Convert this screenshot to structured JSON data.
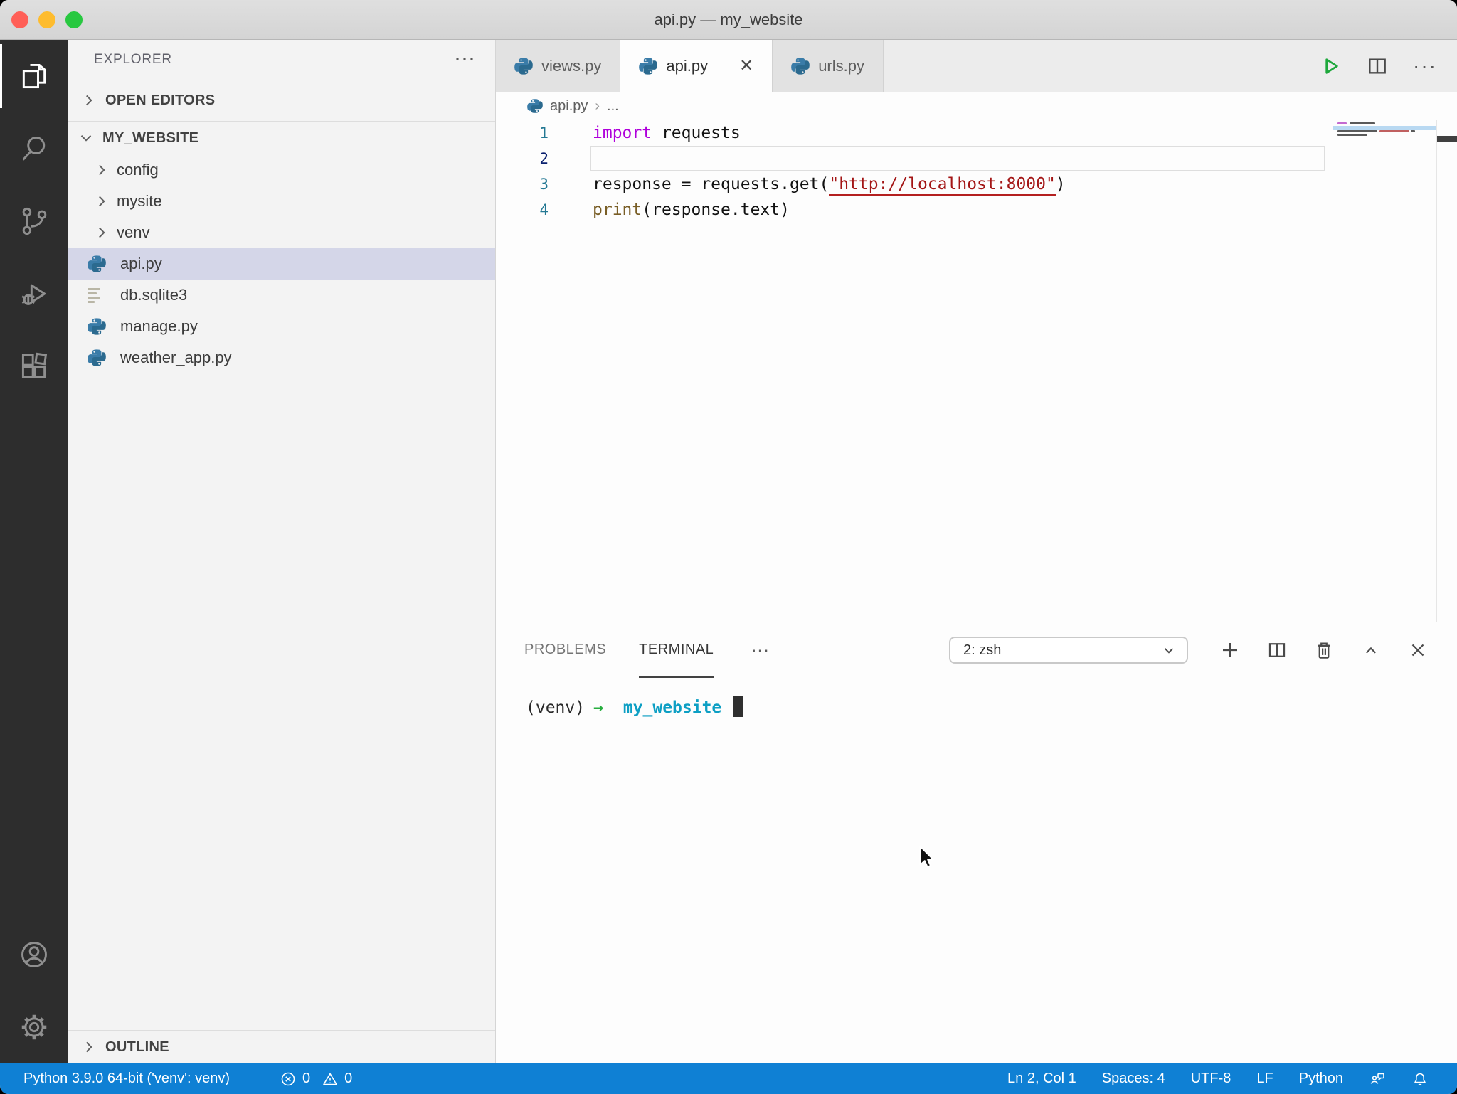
{
  "window": {
    "title": "api.py — my_website"
  },
  "activity_bar": {
    "items": [
      "Explorer",
      "Search",
      "Source Control",
      "Run and Debug",
      "Extensions",
      "Accounts",
      "Settings"
    ]
  },
  "sidebar": {
    "header": "EXPLORER",
    "header_menu": "⋯",
    "open_editors": "OPEN EDITORS",
    "root": "MY_WEBSITE",
    "outline": "OUTLINE",
    "tree": [
      {
        "label": "config"
      },
      {
        "label": "mysite"
      },
      {
        "label": "venv"
      },
      {
        "label": "api.py"
      },
      {
        "label": "db.sqlite3"
      },
      {
        "label": "manage.py"
      },
      {
        "label": "weather_app.py"
      }
    ]
  },
  "editor": {
    "tabs": [
      {
        "label": "views.py"
      },
      {
        "label": "api.py",
        "close": "✕"
      },
      {
        "label": "urls.py"
      }
    ],
    "breadcrumb": {
      "file": "api.py",
      "sep": "›",
      "more": "..."
    },
    "code": {
      "lines": [
        {
          "num": "1",
          "tokens": [
            {
              "t": "import"
            },
            {
              "t": " requests"
            }
          ]
        },
        {
          "num": "2",
          "tokens": []
        },
        {
          "num": "3",
          "tokens": [
            {
              "t": "response = requests.get("
            },
            {
              "t": "\"http://localhost:8000\""
            },
            {
              "t": ")"
            }
          ]
        },
        {
          "num": "4",
          "tokens": [
            {
              "t": "print"
            },
            {
              "t": "(response.text)"
            }
          ]
        }
      ]
    }
  },
  "panel": {
    "problems_tab": "PROBLEMS",
    "terminal_tab": "TERMINAL",
    "more": "⋯",
    "shell_selector": "2: zsh",
    "terminal": {
      "prompt_env": "(venv)",
      "prompt_arrow": "→",
      "prompt_dir": "my_website"
    }
  },
  "status_bar": {
    "interpreter": "Python 3.9.0 64-bit ('venv': venv)",
    "errors": "0",
    "warnings": "0",
    "cursor_position": "Ln 2, Col 1",
    "indentation": "Spaces: 4",
    "encoding": "UTF-8",
    "eol": "LF",
    "language": "Python"
  },
  "colors": {
    "status_bar_bg": "#0f80d4",
    "keyword": "#AF00DB",
    "string": "#A31515",
    "function": "#795E26",
    "selected_row": "#d4d6e8",
    "activity_bar_bg": "#2d2d2d"
  }
}
